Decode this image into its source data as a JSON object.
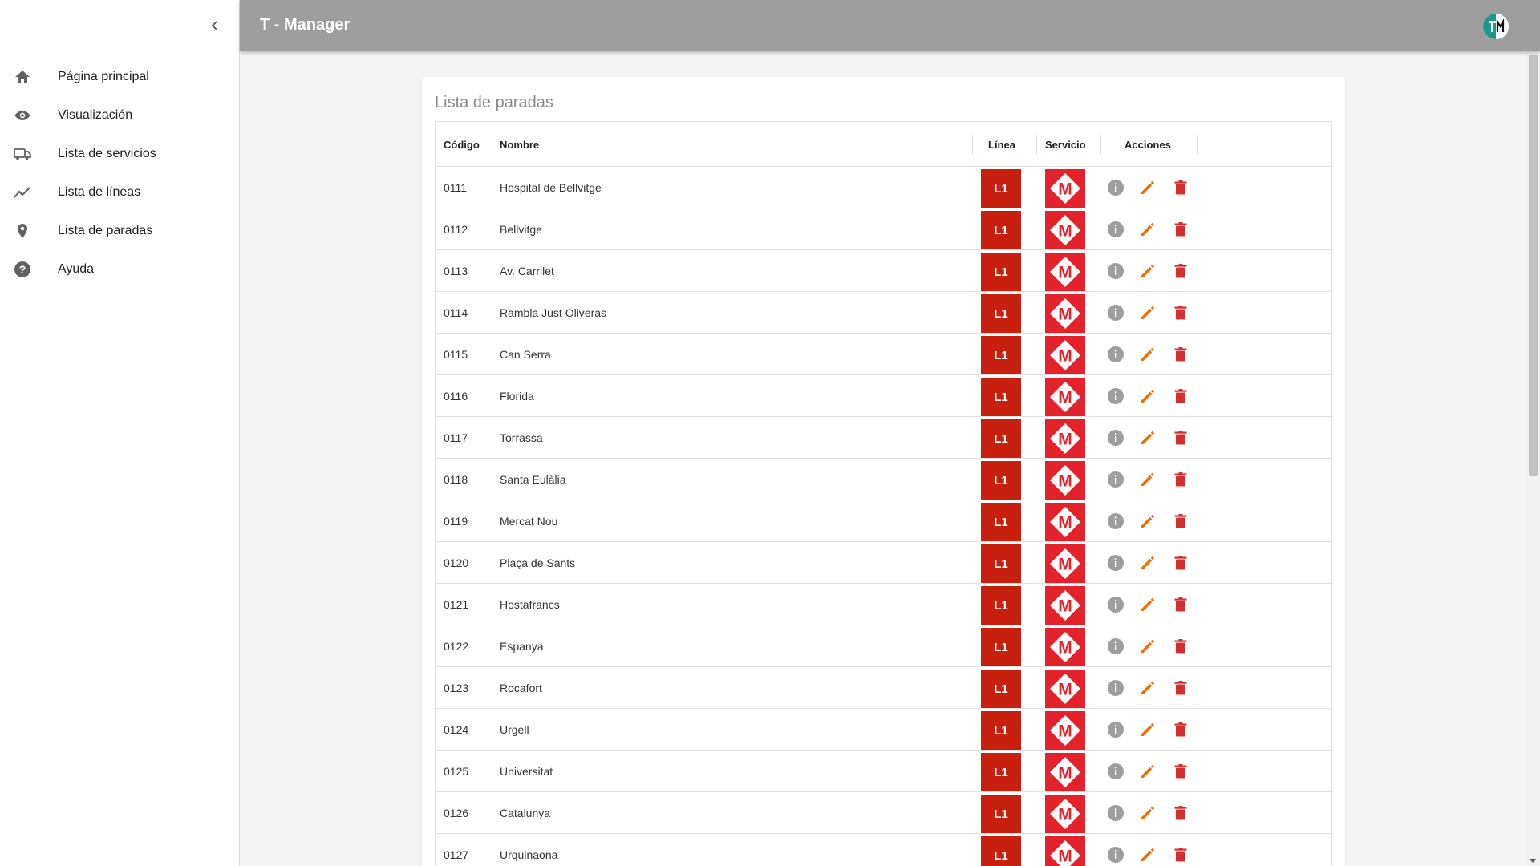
{
  "app": {
    "title": "T - Manager"
  },
  "sidebar": {
    "items": [
      {
        "label": "Página principal",
        "icon": "home-icon"
      },
      {
        "label": "Visualización",
        "icon": "eye-icon"
      },
      {
        "label": "Lista de servicios",
        "icon": "bus-icon"
      },
      {
        "label": "Lista de líneas",
        "icon": "trending-line-icon"
      },
      {
        "label": "Lista de paradas",
        "icon": "location-pin-icon"
      },
      {
        "label": "Ayuda",
        "icon": "help-icon"
      }
    ]
  },
  "main": {
    "title": "Lista de paradas",
    "columns": {
      "code": "Código",
      "name": "Nombre",
      "line": "Línea",
      "service": "Servicio",
      "actions": "Acciones"
    },
    "rows": [
      {
        "code": "0111",
        "name": "Hospital de Bellvitge",
        "line": "L1",
        "service": "M"
      },
      {
        "code": "0112",
        "name": "Bellvitge",
        "line": "L1",
        "service": "M"
      },
      {
        "code": "0113",
        "name": "Av. Carrilet",
        "line": "L1",
        "service": "M"
      },
      {
        "code": "0114",
        "name": "Rambla Just Oliveras",
        "line": "L1",
        "service": "M"
      },
      {
        "code": "0115",
        "name": "Can Serra",
        "line": "L1",
        "service": "M"
      },
      {
        "code": "0116",
        "name": "Florida",
        "line": "L1",
        "service": "M"
      },
      {
        "code": "0117",
        "name": "Torrassa",
        "line": "L1",
        "service": "M"
      },
      {
        "code": "0118",
        "name": "Santa Eulàlia",
        "line": "L1",
        "service": "M"
      },
      {
        "code": "0119",
        "name": "Mercat Nou",
        "line": "L1",
        "service": "M"
      },
      {
        "code": "0120",
        "name": "Plaça de Sants",
        "line": "L1",
        "service": "M"
      },
      {
        "code": "0121",
        "name": "Hostafrancs",
        "line": "L1",
        "service": "M"
      },
      {
        "code": "0122",
        "name": "Espanya",
        "line": "L1",
        "service": "M"
      },
      {
        "code": "0123",
        "name": "Rocafort",
        "line": "L1",
        "service": "M"
      },
      {
        "code": "0124",
        "name": "Urgell",
        "line": "L1",
        "service": "M"
      },
      {
        "code": "0125",
        "name": "Universitat",
        "line": "L1",
        "service": "M"
      },
      {
        "code": "0126",
        "name": "Catalunya",
        "line": "L1",
        "service": "M"
      },
      {
        "code": "0127",
        "name": "Urquinaona",
        "line": "L1",
        "service": "M"
      }
    ]
  },
  "colors": {
    "header_bg": "#9e9e9e",
    "line_l1": "#c8200e",
    "service_metro": "#e3222c",
    "edit_icon": "#ef6c00",
    "delete_icon": "#d32f2f",
    "info_icon": "#9e9e9e"
  }
}
